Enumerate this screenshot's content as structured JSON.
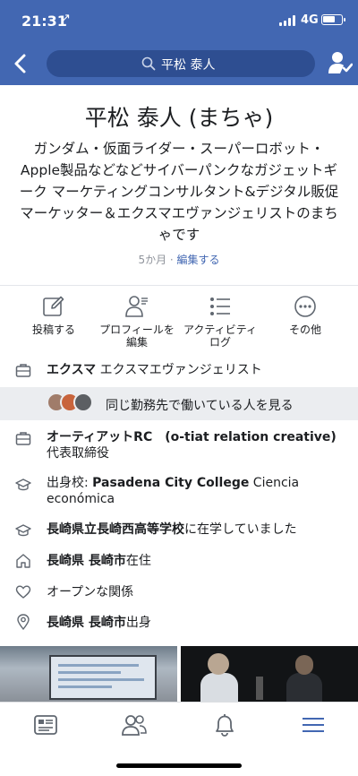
{
  "status_bar": {
    "time": "21:31",
    "location_arrow": "↗",
    "network": "4G"
  },
  "nav": {
    "search_text": "平松 泰人"
  },
  "profile": {
    "name": "平松 泰人 (まちゃ)",
    "bio": "ガンダム・仮面ライダー・スーパーロボット・Apple製品などなどサイバーパンクなガジェットギーク マーケティングコンサルタント&デジタル販促マーケッター＆エクスマエヴァンジェリストのまちゃです",
    "meta_age": "5か月 · ",
    "meta_edit": "編集する"
  },
  "actions": [
    {
      "label": "投稿する",
      "icon": "compose-icon"
    },
    {
      "label": "プロフィールを編集",
      "icon": "edit-profile-icon"
    },
    {
      "label": "アクティビティログ",
      "icon": "activity-log-icon"
    },
    {
      "label": "その他",
      "icon": "more-icon"
    }
  ],
  "about": {
    "work1": {
      "org": "エクスマ",
      "role": " エクスマエヴァンジェリスト"
    },
    "coworkers_text": "同じ勤務先で働いている人を見る",
    "work2": {
      "org": "オーティアットRC　(o-tiat relation creative)",
      "role": "代表取締役"
    },
    "edu1": {
      "prefix": "出身校: ",
      "school": "Pasadena City College",
      "field": " Ciencia económica"
    },
    "edu2": {
      "school": "長崎県立長崎西高等学校",
      "suffix": "に在学していました"
    },
    "lives": {
      "pref": "長崎県 ",
      "city": "長崎市",
      "suffix": "在住"
    },
    "relationship": "オープンな関係",
    "hometown": {
      "pref": "長崎県 ",
      "city": "長崎市",
      "suffix": "出身"
    }
  },
  "tabbar": [
    "news-feed-icon",
    "friends-icon",
    "notifications-icon",
    "menu-icon"
  ],
  "colors": {
    "brand_blue": "#4267b2",
    "search_bg": "#2e4e91",
    "link": "#4267b2",
    "muted": "#90949c",
    "active_tab": "#4267b2"
  }
}
